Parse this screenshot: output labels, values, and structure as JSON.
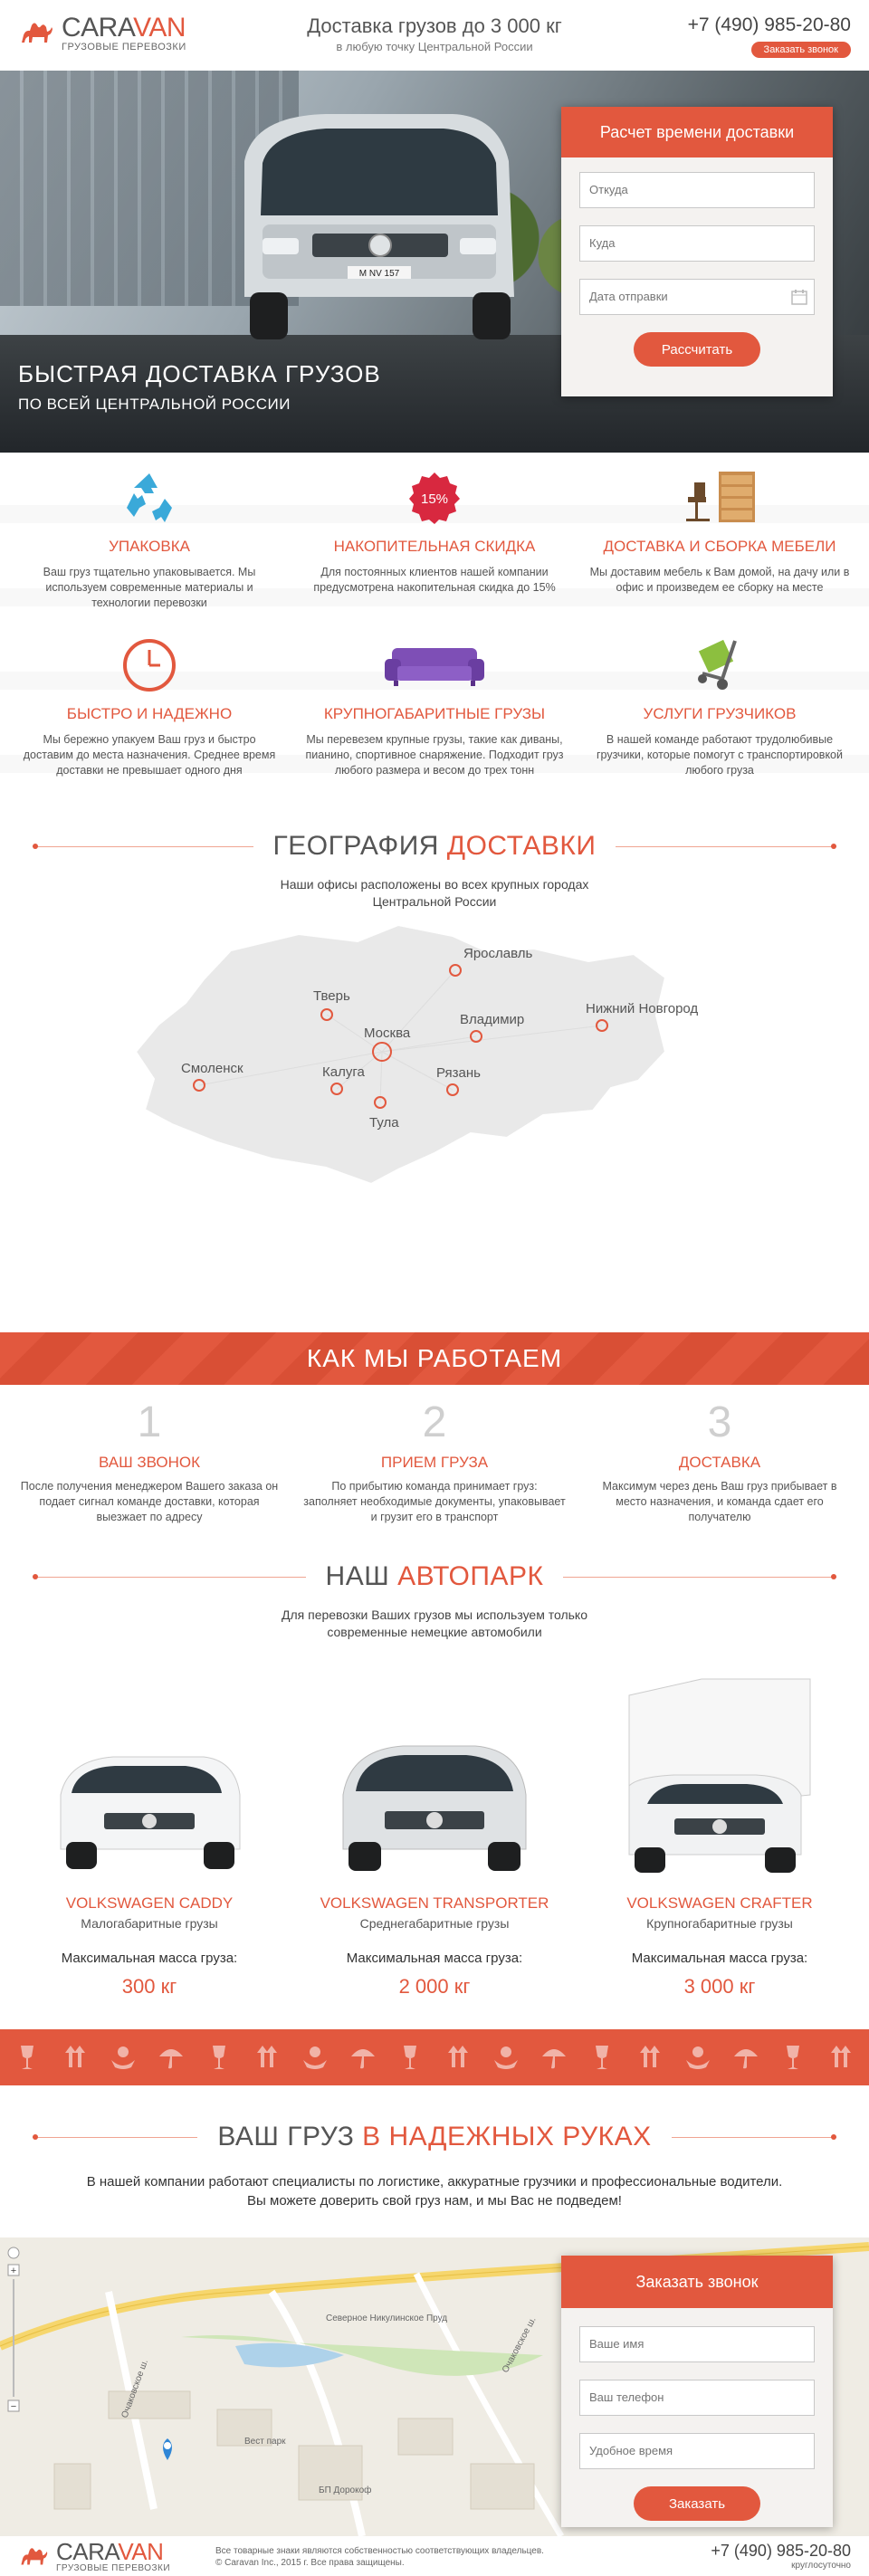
{
  "header": {
    "logo_name_1": "CARA",
    "logo_name_2": "VAN",
    "logo_sub": "ГРУЗОВЫЕ ПЕРЕВОЗКИ",
    "title": "Доставка грузов до 3 000 кг",
    "subtitle": "в любую точку Центральной России",
    "phone": "+7 (490) 985-20-80",
    "call_button": "Заказать звонок"
  },
  "hero": {
    "title": "БЫСТРАЯ ДОСТАВКА ГРУЗОВ",
    "subtitle": "ПО ВСЕЙ ЦЕНТРАЛЬНОЙ РОССИИ",
    "plate": "M NV 157",
    "form": {
      "title": "Расчет времени доставки",
      "from_placeholder": "Откуда",
      "to_placeholder": "Куда",
      "date_placeholder": "Дата отправки",
      "submit": "Рассчитать"
    }
  },
  "features": [
    {
      "icon": "recycle-icon",
      "title": "УПАКОВКА",
      "text": "Ваш груз тщательно упаковывается. Мы используем современные материалы и технологии перевозки"
    },
    {
      "icon": "discount-badge-icon",
      "badge": "15%",
      "title": "НАКОПИТЕЛЬНАЯ СКИДКА",
      "text": "Для постоянных клиентов нашей компании предусмотрена накопительная скидка до 15%"
    },
    {
      "icon": "furniture-icon",
      "title": "ДОСТАВКА И СБОРКА МЕБЕЛИ",
      "text": "Мы доставим мебель к Вам домой, на дачу или в офис и произведем ее сборку на месте"
    },
    {
      "icon": "clock-icon",
      "title": "БЫСТРО И НАДЕЖНО",
      "text": "Мы бережно упакуем Ваш груз и быстро доставим до места назначения. Среднее время доставки не превышает одного дня"
    },
    {
      "icon": "sofa-icon",
      "title": "КРУПНОГАБАРИТНЫЕ ГРУЗЫ",
      "text": "Мы перевезем крупные грузы, такие как диваны, пианино, спортивное снаряжение. Подходит груз любого размера и весом до трех тонн"
    },
    {
      "icon": "hand-truck-icon",
      "title": "УСЛУГИ ГРУЗЧИКОВ",
      "text": "В нашей команде работают трудолюбивые грузчики, которые помогут с транспортировкой любого груза"
    }
  ],
  "geo": {
    "title_1": "ГЕОГРАФИЯ ",
    "title_2": "ДОСТАВКИ",
    "subtitle_1": "Наши офисы расположены во всех крупных городах",
    "subtitle_2": "Центральной России",
    "cities": [
      "Ярославль",
      "Тверь",
      "Москва",
      "Владимир",
      "Нижний Новгород",
      "Смоленск",
      "Калуга",
      "Рязань",
      "Тула"
    ]
  },
  "how": {
    "title": "КАК МЫ РАБОТАЕМ",
    "steps": [
      {
        "num": "1",
        "title": "ВАШ ЗВОНОК",
        "text": "После получения менеджером Вашего заказа он подает сигнал команде доставки, которая выезжает по адресу"
      },
      {
        "num": "2",
        "title": "ПРИЕМ ГРУЗА",
        "text": "По прибытию команда принимает груз: заполняет необходимые документы, упаковывает и грузит его в транспорт"
      },
      {
        "num": "3",
        "title": "ДОСТАВКА",
        "text": "Максимум через день Ваш груз прибывает в место назначения, и команда сдает его получателю"
      }
    ]
  },
  "fleet": {
    "title_1": "НАШ ",
    "title_2": "АВТОПАРК",
    "subtitle_1": "Для перевозки Ваших грузов мы используем только",
    "subtitle_2": "современные немецкие автомобили",
    "mass_label": "Максимальная масса груза:",
    "cars": [
      {
        "name": "VOLKSWAGEN CADDY",
        "type": "Малогабаритные грузы",
        "mass": "300 кг"
      },
      {
        "name": "VOLKSWAGEN TRANSPORTER",
        "type": "Среднегабаритные грузы",
        "mass": "2 000 кг"
      },
      {
        "name": "VOLKSWAGEN CRAFTER",
        "type": "Крупногабаритные грузы",
        "mass": "3 000 кг"
      }
    ]
  },
  "reliability": {
    "title_1": "ВАШ ГРУЗ ",
    "title_2": "В НАДЕЖНЫХ РУКАХ",
    "text_1": "В нашей компании работают специалисты по логистике, аккуратные грузчики и профессиональные водители.",
    "text_2": "Вы можете доверить свой груз нам, и мы Вас не подведем!"
  },
  "map": {
    "labels": [
      "Вест парк",
      "БП Дорокоф",
      "Очаковское ш.",
      "Очаковское ш.",
      "Северное Никулинское Пруд"
    ],
    "callback": {
      "title": "Заказать звонок",
      "name_placeholder": "Ваше имя",
      "phone_placeholder": "Ваш телефон",
      "time_placeholder": "Удобное время",
      "submit": "Заказать"
    }
  },
  "footer": {
    "copy_1": "Все товарные знаки являются собственностью соответствующих владельцев.",
    "copy_2": "© Caravan Inc., 2015 г. Все права защищены.",
    "phone": "+7 (490) 985-20-80",
    "hours": "круглосуточно"
  },
  "colors": {
    "accent": "#e2583e",
    "text": "#444444"
  }
}
